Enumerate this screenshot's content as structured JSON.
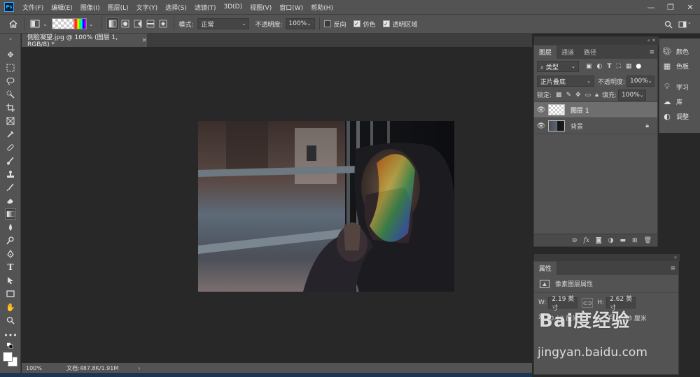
{
  "menubar": {
    "logo": "Ps",
    "items": [
      "文件(F)",
      "编辑(E)",
      "图像(I)",
      "图层(L)",
      "文字(Y)",
      "选择(S)",
      "滤镜(T)",
      "3D(D)",
      "视图(V)",
      "窗口(W)",
      "帮助(H)"
    ],
    "window_controls": [
      "—",
      "❐",
      "✕"
    ]
  },
  "options": {
    "mode_label": "模式:",
    "mode_value": "正常",
    "opacity_label": "不透明度:",
    "opacity_value": "100%",
    "reverse_label": "反向",
    "dither_label": "仿色",
    "transparency_label": "透明区域",
    "reverse_checked": false,
    "dither_checked": true,
    "transparency_checked": true
  },
  "document": {
    "tab_title": "侧脸凝望.jpg @ 100% (图层 1, RGB/8) *",
    "close": "×"
  },
  "status": {
    "zoom": "100%",
    "doc_info": "文档:487.8K/1.91M",
    "arrow": "›"
  },
  "layers_panel": {
    "tabs": [
      "图层",
      "通道",
      "路径"
    ],
    "filter_label": "类型",
    "blend_mode": "正片叠底",
    "opacity_label": "不透明度:",
    "opacity_value": "100%",
    "lock_label": "锁定:",
    "fill_label": "填充:",
    "fill_value": "100%",
    "layers": [
      {
        "name": "图层 1",
        "selected": true,
        "locked": false
      },
      {
        "name": "背景",
        "selected": false,
        "locked": true
      }
    ]
  },
  "right_rail": [
    {
      "label": "颜色",
      "icon": "color-icon"
    },
    {
      "label": "色板",
      "icon": "swatches-icon"
    },
    {
      "label": "学习",
      "icon": "learn-icon"
    },
    {
      "label": "库",
      "icon": "libraries-icon"
    },
    {
      "label": "调整",
      "icon": "adjustments-icon"
    }
  ],
  "properties_panel": {
    "tab": "属性",
    "subtitle": "像素图层属性",
    "w_label": "W:",
    "w_value": "2.19 英寸",
    "h_label": "H:",
    "h_value": "2.62 英寸",
    "x_label": "X:",
    "x_value": "-0.13 厘米",
    "y_label": "Y:",
    "y_value": "-1.53 厘米"
  },
  "watermark": {
    "brand": "Bai度经验",
    "url": "jingyan.baidu.com"
  },
  "colors": {
    "ui_panel": "#535353",
    "canvas_bg": "#282828",
    "ps_blue": "#31a8ff"
  }
}
